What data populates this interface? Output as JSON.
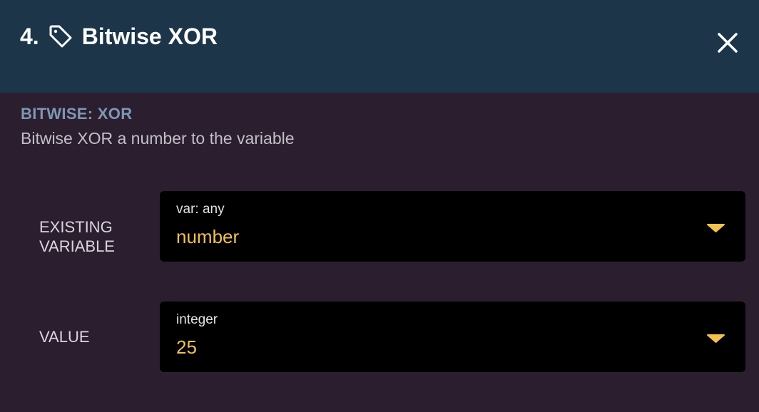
{
  "header": {
    "step_number": "4.",
    "title": "Bitwise XOR",
    "icon": "tag-icon",
    "close_icon": "close-icon",
    "background": "#1c3549"
  },
  "section": {
    "title": "BITWISE: XOR",
    "description": "Bitwise XOR a number to the variable"
  },
  "fields": [
    {
      "label_line1": "EXISTING",
      "label_line2": "VARIABLE",
      "type_label": "var: any",
      "value": "number",
      "icon": "chevron-down-icon"
    },
    {
      "label_line1": "VALUE",
      "type_label": "integer",
      "value": "25",
      "icon": "chevron-down-icon"
    }
  ],
  "colors": {
    "body_background": "#2b1f2f",
    "accent": "#f2c14e",
    "section_title": "#7d97b3",
    "select_background": "#000000"
  }
}
